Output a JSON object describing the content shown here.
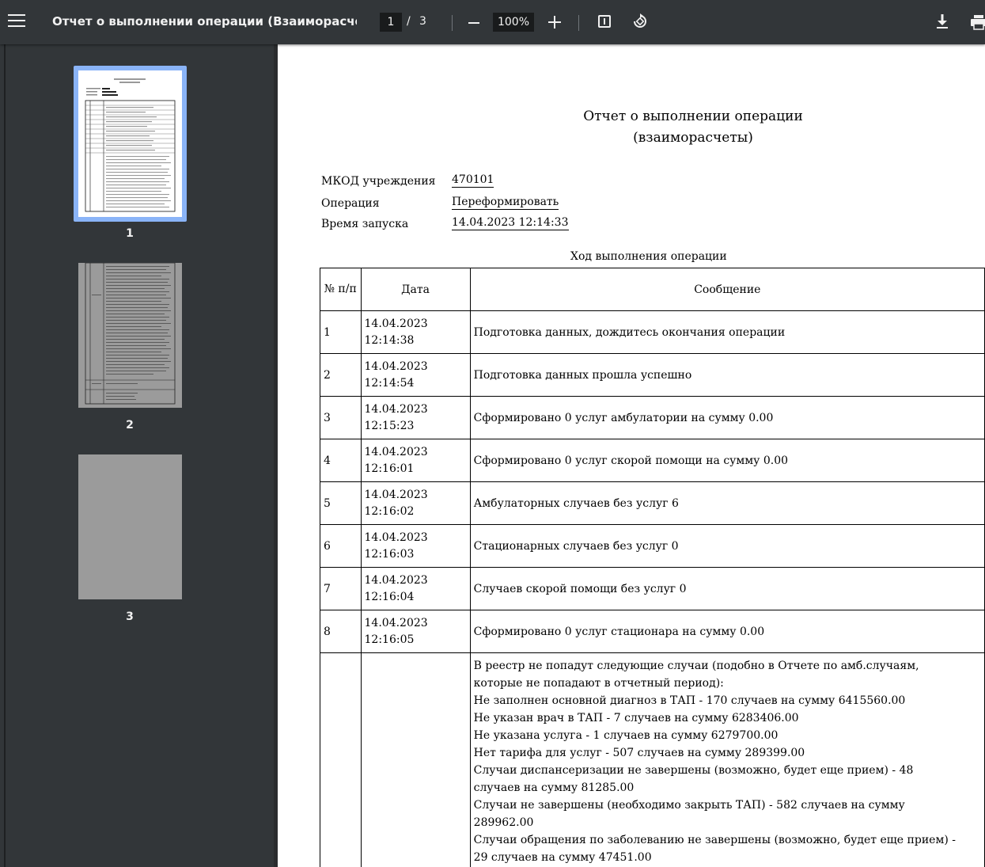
{
  "toolbar": {
    "title": "Отчет о выполнении операции (Взаиморасчет...",
    "current_page": "1",
    "page_separator": "/",
    "total_pages": "3",
    "zoom": "100%"
  },
  "thumbnails": [
    {
      "label": "1",
      "selected": true
    },
    {
      "label": "2",
      "selected": false
    },
    {
      "label": "3",
      "selected": false
    }
  ],
  "report": {
    "title_line1": "Отчет о выполнении операции",
    "title_line2": "(взаиморасчеты)",
    "fields": {
      "mkod_label": "МКОД учреждения",
      "mkod_value": "470101",
      "operation_label": "Операция",
      "operation_value": "Переформировать",
      "start_label": "Время запуска",
      "start_value": "14.04.2023 12:14:33"
    },
    "table_caption": "Ход выполнения операции",
    "columns": {
      "no": "№ п/п",
      "date": "Дата",
      "message": "Сообщение"
    },
    "rows": [
      {
        "no": "1",
        "date": "14.04.2023",
        "time": "12:14:38",
        "message": "Подготовка данных, дождитесь окончания операции"
      },
      {
        "no": "2",
        "date": "14.04.2023",
        "time": "12:14:54",
        "message": "Подготовка данных прошла успешно"
      },
      {
        "no": "3",
        "date": "14.04.2023",
        "time": "12:15:23",
        "message": "Сформировано 0 услуг амбулатории на сумму 0.00"
      },
      {
        "no": "4",
        "date": "14.04.2023",
        "time": "12:16:01",
        "message": "Сформировано 0 услуг скорой помощи на сумму 0.00"
      },
      {
        "no": "5",
        "date": "14.04.2023",
        "time": "12:16:02",
        "message": "Амбулаторных случаев без услуг 6"
      },
      {
        "no": "6",
        "date": "14.04.2023",
        "time": "12:16:03",
        "message": "Стационарных случаев без услуг 0"
      },
      {
        "no": "7",
        "date": "14.04.2023",
        "time": "12:16:04",
        "message": "Случаев скорой помощи без услуг 0"
      },
      {
        "no": "8",
        "date": "14.04.2023",
        "time": "12:16:05",
        "message": "Сформировано 0 услуг стационара на сумму 0.00"
      }
    ],
    "long_row_lines": [
      "В реестр не попадут следующие случаи (подобно в Отчете по амб.случаям,",
      "которые не попадают в отчетный период):",
      "Не заполнен основной диагноз в ТАП - 170 случаев на сумму 6415560.00",
      "Не указан врач в ТАП - 7 случаев на сумму 6283406.00",
      "Не указана услуга - 1 случаев на сумму 6279700.00",
      "Нет тарифа для услуг - 507 случаев на сумму 289399.00",
      "Случаи диспансеризации не завершены (возможно, будет еще прием) - 48",
      "случаев на сумму 81285.00",
      "Случаи не завершены (необходимо закрыть ТАП) - 582 случаев на сумму",
      "289962.00",
      "Случаи обращения по заболеванию не завершены (возможно, будет еще прием) -",
      "29 случаев на сумму 47451.00"
    ]
  }
}
